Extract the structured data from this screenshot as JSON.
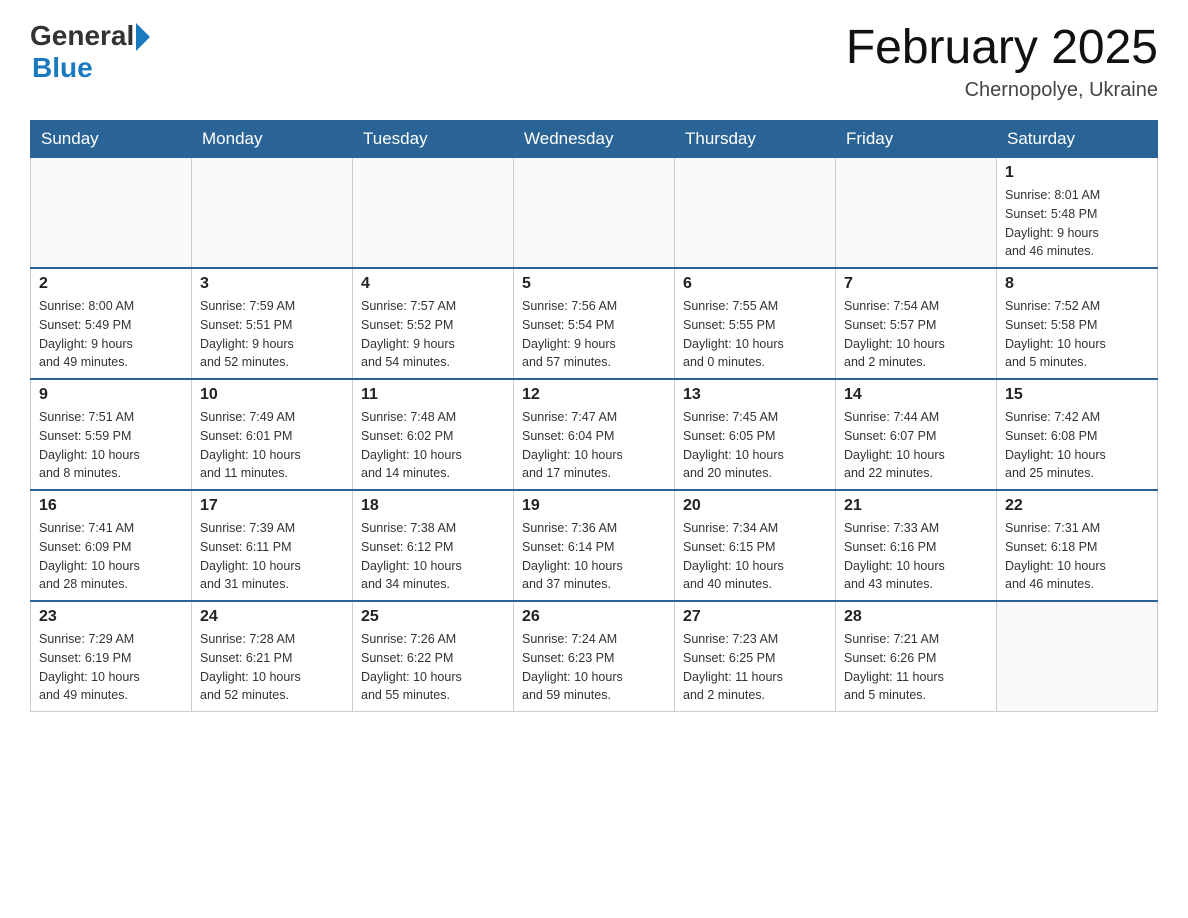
{
  "header": {
    "logo_general": "General",
    "logo_blue": "Blue",
    "title": "February 2025",
    "subtitle": "Chernopolye, Ukraine"
  },
  "weekdays": [
    "Sunday",
    "Monday",
    "Tuesday",
    "Wednesday",
    "Thursday",
    "Friday",
    "Saturday"
  ],
  "weeks": [
    [
      {
        "day": "",
        "info": ""
      },
      {
        "day": "",
        "info": ""
      },
      {
        "day": "",
        "info": ""
      },
      {
        "day": "",
        "info": ""
      },
      {
        "day": "",
        "info": ""
      },
      {
        "day": "",
        "info": ""
      },
      {
        "day": "1",
        "info": "Sunrise: 8:01 AM\nSunset: 5:48 PM\nDaylight: 9 hours\nand 46 minutes."
      }
    ],
    [
      {
        "day": "2",
        "info": "Sunrise: 8:00 AM\nSunset: 5:49 PM\nDaylight: 9 hours\nand 49 minutes."
      },
      {
        "day": "3",
        "info": "Sunrise: 7:59 AM\nSunset: 5:51 PM\nDaylight: 9 hours\nand 52 minutes."
      },
      {
        "day": "4",
        "info": "Sunrise: 7:57 AM\nSunset: 5:52 PM\nDaylight: 9 hours\nand 54 minutes."
      },
      {
        "day": "5",
        "info": "Sunrise: 7:56 AM\nSunset: 5:54 PM\nDaylight: 9 hours\nand 57 minutes."
      },
      {
        "day": "6",
        "info": "Sunrise: 7:55 AM\nSunset: 5:55 PM\nDaylight: 10 hours\nand 0 minutes."
      },
      {
        "day": "7",
        "info": "Sunrise: 7:54 AM\nSunset: 5:57 PM\nDaylight: 10 hours\nand 2 minutes."
      },
      {
        "day": "8",
        "info": "Sunrise: 7:52 AM\nSunset: 5:58 PM\nDaylight: 10 hours\nand 5 minutes."
      }
    ],
    [
      {
        "day": "9",
        "info": "Sunrise: 7:51 AM\nSunset: 5:59 PM\nDaylight: 10 hours\nand 8 minutes."
      },
      {
        "day": "10",
        "info": "Sunrise: 7:49 AM\nSunset: 6:01 PM\nDaylight: 10 hours\nand 11 minutes."
      },
      {
        "day": "11",
        "info": "Sunrise: 7:48 AM\nSunset: 6:02 PM\nDaylight: 10 hours\nand 14 minutes."
      },
      {
        "day": "12",
        "info": "Sunrise: 7:47 AM\nSunset: 6:04 PM\nDaylight: 10 hours\nand 17 minutes."
      },
      {
        "day": "13",
        "info": "Sunrise: 7:45 AM\nSunset: 6:05 PM\nDaylight: 10 hours\nand 20 minutes."
      },
      {
        "day": "14",
        "info": "Sunrise: 7:44 AM\nSunset: 6:07 PM\nDaylight: 10 hours\nand 22 minutes."
      },
      {
        "day": "15",
        "info": "Sunrise: 7:42 AM\nSunset: 6:08 PM\nDaylight: 10 hours\nand 25 minutes."
      }
    ],
    [
      {
        "day": "16",
        "info": "Sunrise: 7:41 AM\nSunset: 6:09 PM\nDaylight: 10 hours\nand 28 minutes."
      },
      {
        "day": "17",
        "info": "Sunrise: 7:39 AM\nSunset: 6:11 PM\nDaylight: 10 hours\nand 31 minutes."
      },
      {
        "day": "18",
        "info": "Sunrise: 7:38 AM\nSunset: 6:12 PM\nDaylight: 10 hours\nand 34 minutes."
      },
      {
        "day": "19",
        "info": "Sunrise: 7:36 AM\nSunset: 6:14 PM\nDaylight: 10 hours\nand 37 minutes."
      },
      {
        "day": "20",
        "info": "Sunrise: 7:34 AM\nSunset: 6:15 PM\nDaylight: 10 hours\nand 40 minutes."
      },
      {
        "day": "21",
        "info": "Sunrise: 7:33 AM\nSunset: 6:16 PM\nDaylight: 10 hours\nand 43 minutes."
      },
      {
        "day": "22",
        "info": "Sunrise: 7:31 AM\nSunset: 6:18 PM\nDaylight: 10 hours\nand 46 minutes."
      }
    ],
    [
      {
        "day": "23",
        "info": "Sunrise: 7:29 AM\nSunset: 6:19 PM\nDaylight: 10 hours\nand 49 minutes."
      },
      {
        "day": "24",
        "info": "Sunrise: 7:28 AM\nSunset: 6:21 PM\nDaylight: 10 hours\nand 52 minutes."
      },
      {
        "day": "25",
        "info": "Sunrise: 7:26 AM\nSunset: 6:22 PM\nDaylight: 10 hours\nand 55 minutes."
      },
      {
        "day": "26",
        "info": "Sunrise: 7:24 AM\nSunset: 6:23 PM\nDaylight: 10 hours\nand 59 minutes."
      },
      {
        "day": "27",
        "info": "Sunrise: 7:23 AM\nSunset: 6:25 PM\nDaylight: 11 hours\nand 2 minutes."
      },
      {
        "day": "28",
        "info": "Sunrise: 7:21 AM\nSunset: 6:26 PM\nDaylight: 11 hours\nand 5 minutes."
      },
      {
        "day": "",
        "info": ""
      }
    ]
  ]
}
